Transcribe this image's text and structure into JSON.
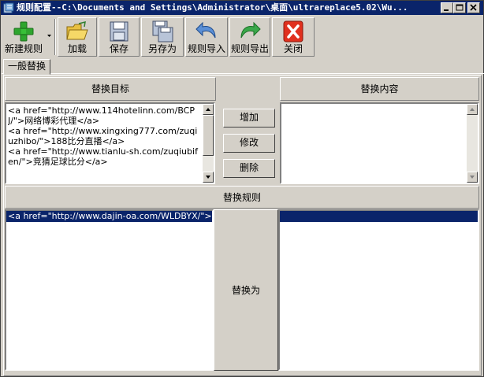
{
  "window": {
    "title": "规则配置--C:\\Documents and Settings\\Administrator\\桌面\\ultrareplace5.02\\Wu..."
  },
  "toolbar": {
    "buttons": [
      {
        "label": "新建规则",
        "icon": "plus-icon"
      },
      {
        "label": "加载",
        "icon": "folder-open-icon"
      },
      {
        "label": "保存",
        "icon": "floppy-disk-icon"
      },
      {
        "label": "另存为",
        "icon": "save-as-icon"
      },
      {
        "label": "规则导入",
        "icon": "import-arrow-icon"
      },
      {
        "label": "规则导出",
        "icon": "export-arrow-icon"
      },
      {
        "label": "关闭",
        "icon": "close-x-icon"
      }
    ]
  },
  "tabs": [
    {
      "label": "一般替换",
      "selected": true
    }
  ],
  "headers": {
    "target": "替换目标",
    "content": "替换内容",
    "rules": "替换规则"
  },
  "target_text": "<a href=\"http://www.114hotelinn.com/BCPJ/\">网络博彩代理</a>\n<a href=\"http://www.xingxing777.com/zuqiuzhibo/\">188比分直播</a>\n<a href=\"http://www.tianlu-sh.com/zuqiubifen/\">竞猜足球比分</a>",
  "content_text": "",
  "actions": {
    "add": "增加",
    "modify": "修改",
    "delete": "删除",
    "replace_with": "替换为"
  },
  "rules_list": {
    "selected_item": "<a href=\"http://www.dajin-oa.com/WLDBYX/\">真人真钱网络棋牌游戏</a>"
  },
  "colors": {
    "face": "#d4d0c8",
    "titlebar": "#0a246a",
    "selection": "#0a246a",
    "close_icon": "#e0301e"
  }
}
